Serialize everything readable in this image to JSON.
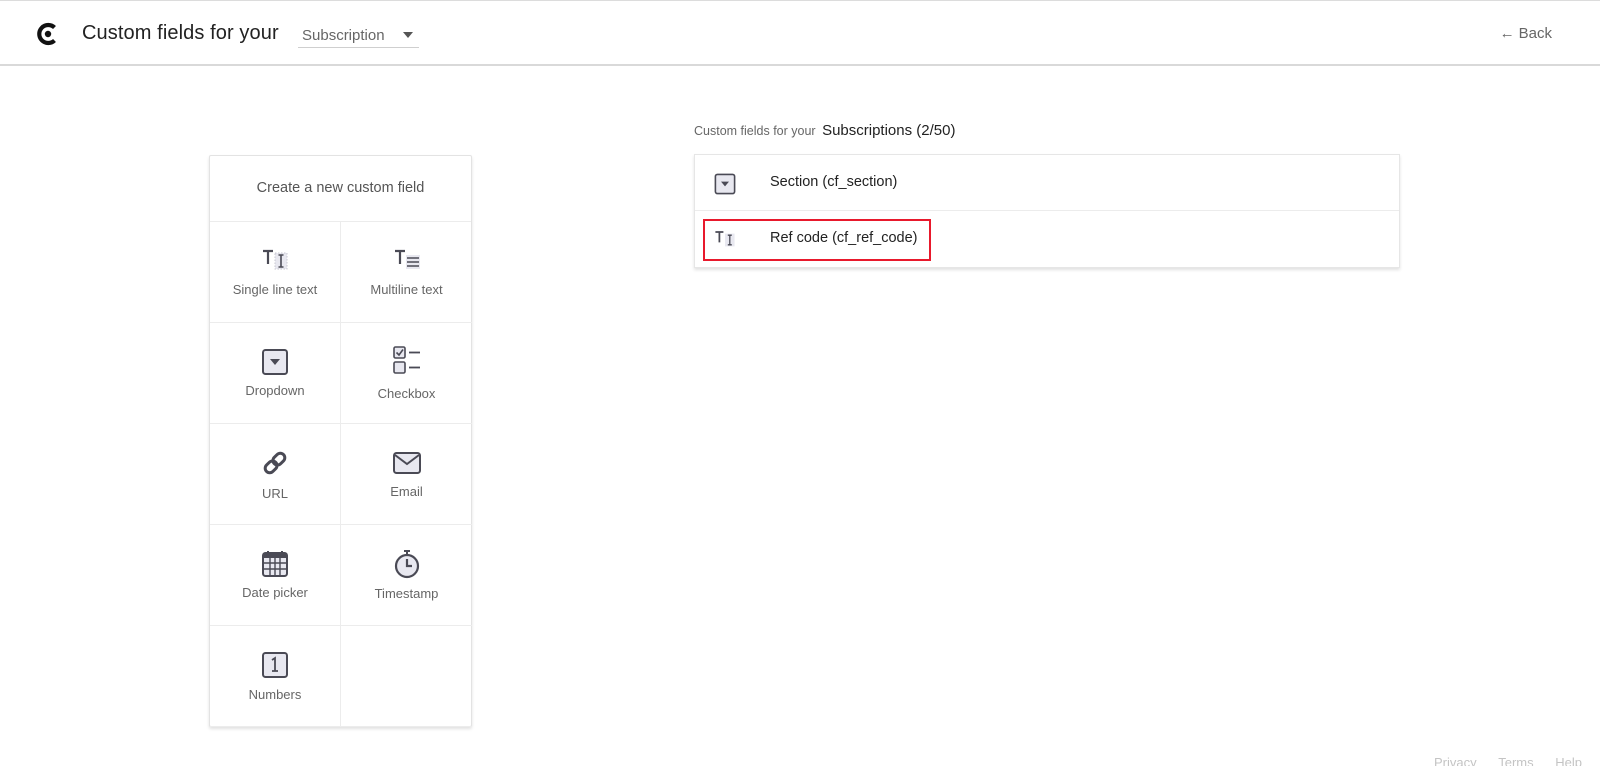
{
  "header": {
    "title": "Custom fields for your",
    "entity_select": {
      "value": "Subscription"
    },
    "back_label": "Back"
  },
  "create_panel": {
    "title": "Create a new custom field",
    "types": [
      {
        "label": "Single line text",
        "icon": "single-line-text-icon"
      },
      {
        "label": "Multiline text",
        "icon": "multiline-text-icon"
      },
      {
        "label": "Dropdown",
        "icon": "dropdown-icon"
      },
      {
        "label": "Checkbox",
        "icon": "checkbox-icon"
      },
      {
        "label": "URL",
        "icon": "link-icon"
      },
      {
        "label": "Email",
        "icon": "envelope-icon"
      },
      {
        "label": "Date picker",
        "icon": "calendar-icon"
      },
      {
        "label": "Timestamp",
        "icon": "stopwatch-icon"
      },
      {
        "label": "Numbers",
        "icon": "number-icon"
      }
    ]
  },
  "field_list": {
    "caption_prefix": "Custom fields for your",
    "caption_entity": "Subscriptions (2/50)",
    "fields": [
      {
        "label": "Section (cf_section)",
        "icon": "dropdown-icon"
      },
      {
        "label": "Ref code (cf_ref_code)",
        "icon": "single-line-text-icon",
        "highlighted": true
      }
    ]
  },
  "footer": {
    "links": [
      "Privacy",
      "Terms",
      "Help"
    ]
  },
  "colors": {
    "highlight": "#e8192c",
    "icon": "#4a4a55",
    "icon_fill": "#e8e8f0"
  }
}
